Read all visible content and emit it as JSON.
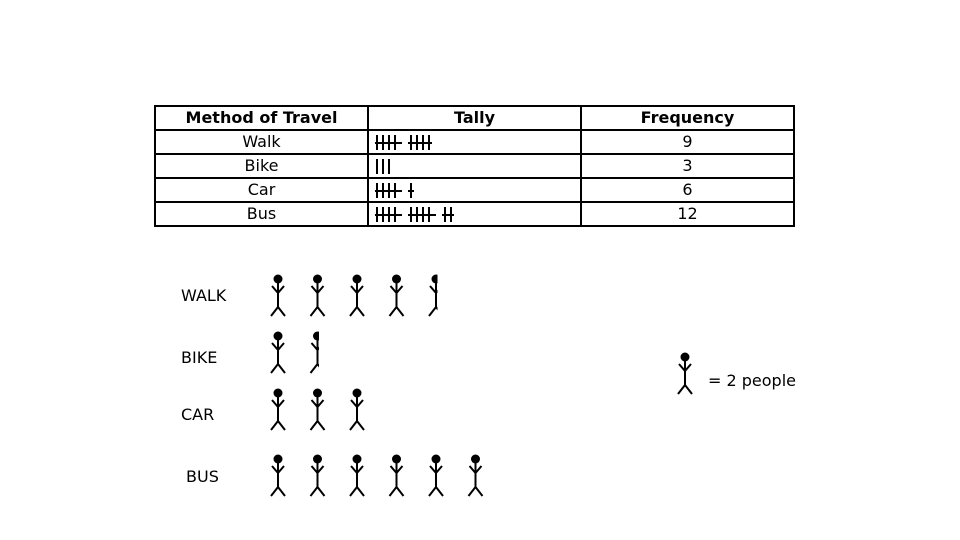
{
  "table": {
    "headers": [
      "Method of Travel",
      "Tally",
      "Frequency"
    ],
    "rows": [
      {
        "method": "Walk",
        "tally": 9,
        "frequency": "9"
      },
      {
        "method": "Bike",
        "tally": 3,
        "frequency": "3"
      },
      {
        "method": "Car",
        "tally": 6,
        "frequency": "6"
      },
      {
        "method": "Bus",
        "tally": 12,
        "frequency": "12"
      }
    ]
  },
  "pictogram": {
    "rows": [
      {
        "label": "WALK",
        "value": 9
      },
      {
        "label": "BIKE",
        "value": 3
      },
      {
        "label": "CAR",
        "value": 6
      },
      {
        "label": "BUS",
        "value": 12
      }
    ],
    "key": {
      "icon": "stick-figure-icon",
      "text": "= 2 people",
      "per_icon": 2
    }
  },
  "chart_data": {
    "type": "table",
    "title": "",
    "categories": [
      "Walk",
      "Bike",
      "Car",
      "Bus"
    ],
    "values": [
      9,
      3,
      6,
      12
    ],
    "columns": [
      "Method of Travel",
      "Tally",
      "Frequency"
    ],
    "pictogram_key": "1 figure = 2 people"
  }
}
